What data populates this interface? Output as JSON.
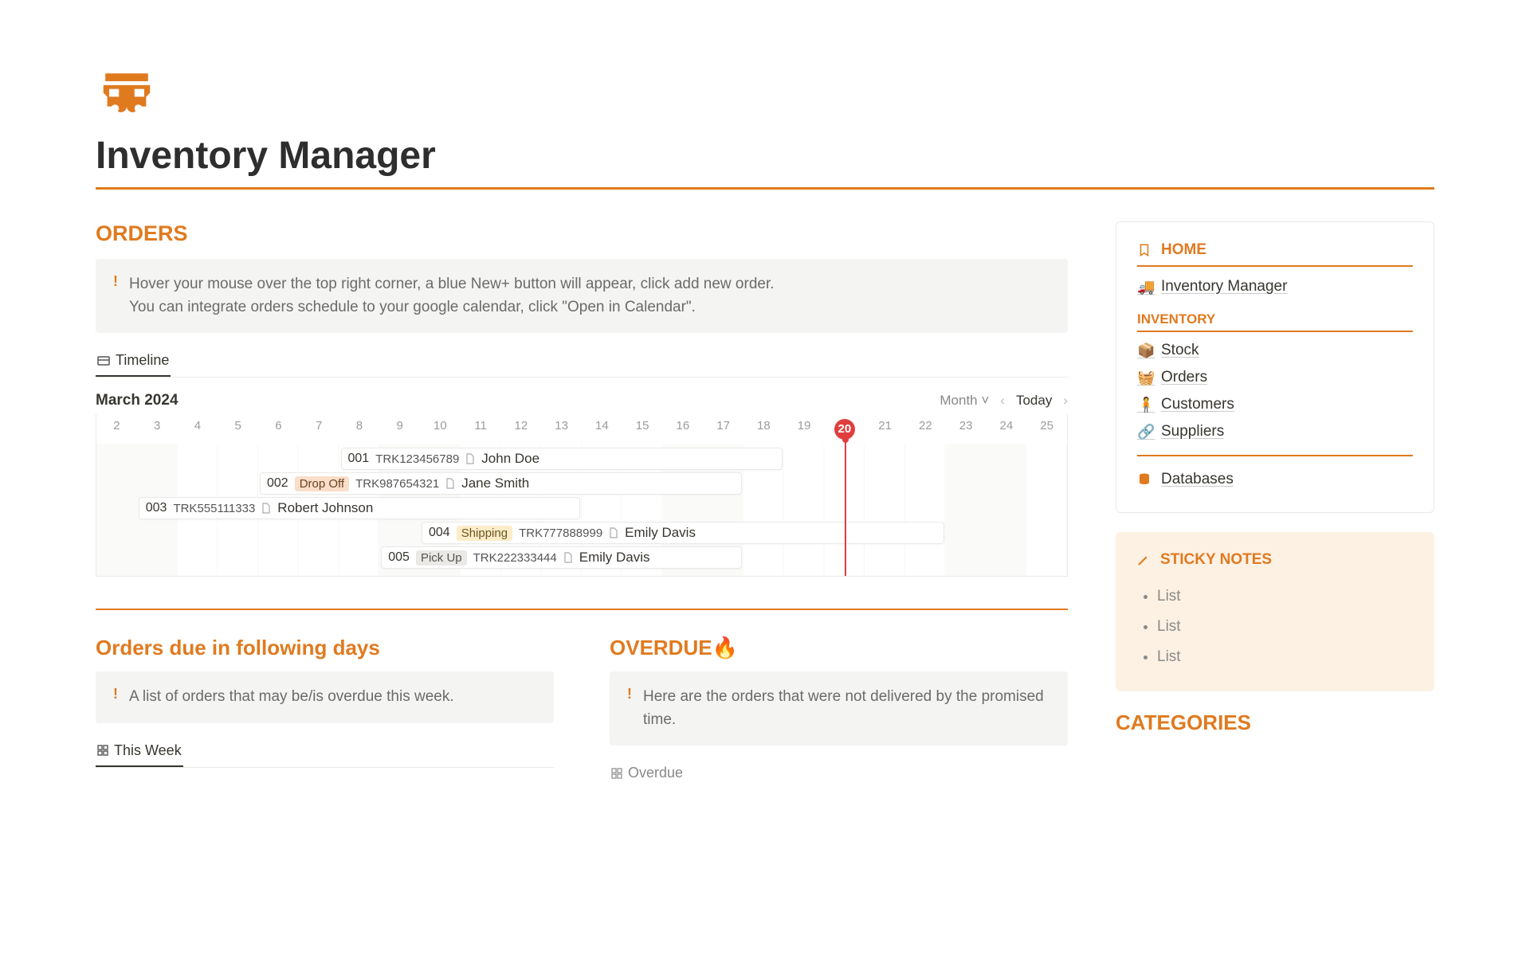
{
  "page": {
    "title": "Inventory Manager"
  },
  "orders": {
    "heading": "ORDERS",
    "callout_line1": "Hover your mouse over the top right corner, a blue New+ button will appear, click add new order.",
    "callout_line2": "You can integrate orders schedule to your google calendar, click \"Open in Calendar\".",
    "tab_label": "Timeline",
    "month_label": "March 2024",
    "view_range": "Month",
    "today_label": "Today",
    "days": [
      "2",
      "3",
      "4",
      "5",
      "6",
      "7",
      "8",
      "9",
      "10",
      "11",
      "12",
      "13",
      "14",
      "15",
      "16",
      "17",
      "18",
      "19",
      "20",
      "21",
      "22",
      "23",
      "24",
      "25"
    ],
    "today_index": 18,
    "items": [
      {
        "num": "001",
        "tag": "",
        "tag_style": "",
        "tracking": "TRK123456789",
        "customer": "John Doe",
        "start": 6,
        "span": 11
      },
      {
        "num": "002",
        "tag": "Drop Off",
        "tag_style": "",
        "tracking": "TRK987654321",
        "customer": "Jane Smith",
        "start": 4,
        "span": 12
      },
      {
        "num": "003",
        "tag": "",
        "tag_style": "",
        "tracking": "TRK555111333",
        "customer": "Robert Johnson",
        "start": 1,
        "span": 11
      },
      {
        "num": "004",
        "tag": "Shipping",
        "tag_style": "yellow",
        "tracking": "TRK777888999",
        "customer": "Emily Davis",
        "start": 8,
        "span": 13
      },
      {
        "num": "005",
        "tag": "Pick Up",
        "tag_style": "gray",
        "tracking": "TRK222333444",
        "customer": "Emily Davis",
        "start": 7,
        "span": 9
      }
    ]
  },
  "due": {
    "heading": "Orders due in following days",
    "callout": "A list of orders that may be/is overdue this week.",
    "tab_label": "This Week"
  },
  "overdue": {
    "heading": "OVERDUE🔥",
    "callout": "Here are the orders that were not delivered by the promised time.",
    "tab_label": "Overdue"
  },
  "sidebar": {
    "home_heading": "HOME",
    "home_link": "Inventory Manager",
    "inventory_heading": "INVENTORY",
    "links": [
      {
        "label": "Stock"
      },
      {
        "label": "Orders"
      },
      {
        "label": "Customers"
      },
      {
        "label": "Suppliers"
      }
    ],
    "databases_label": "Databases",
    "sticky_heading": "STICKY NOTES",
    "sticky_items": [
      "List",
      "List",
      "List"
    ],
    "categories_heading": "CATEGORIES"
  }
}
